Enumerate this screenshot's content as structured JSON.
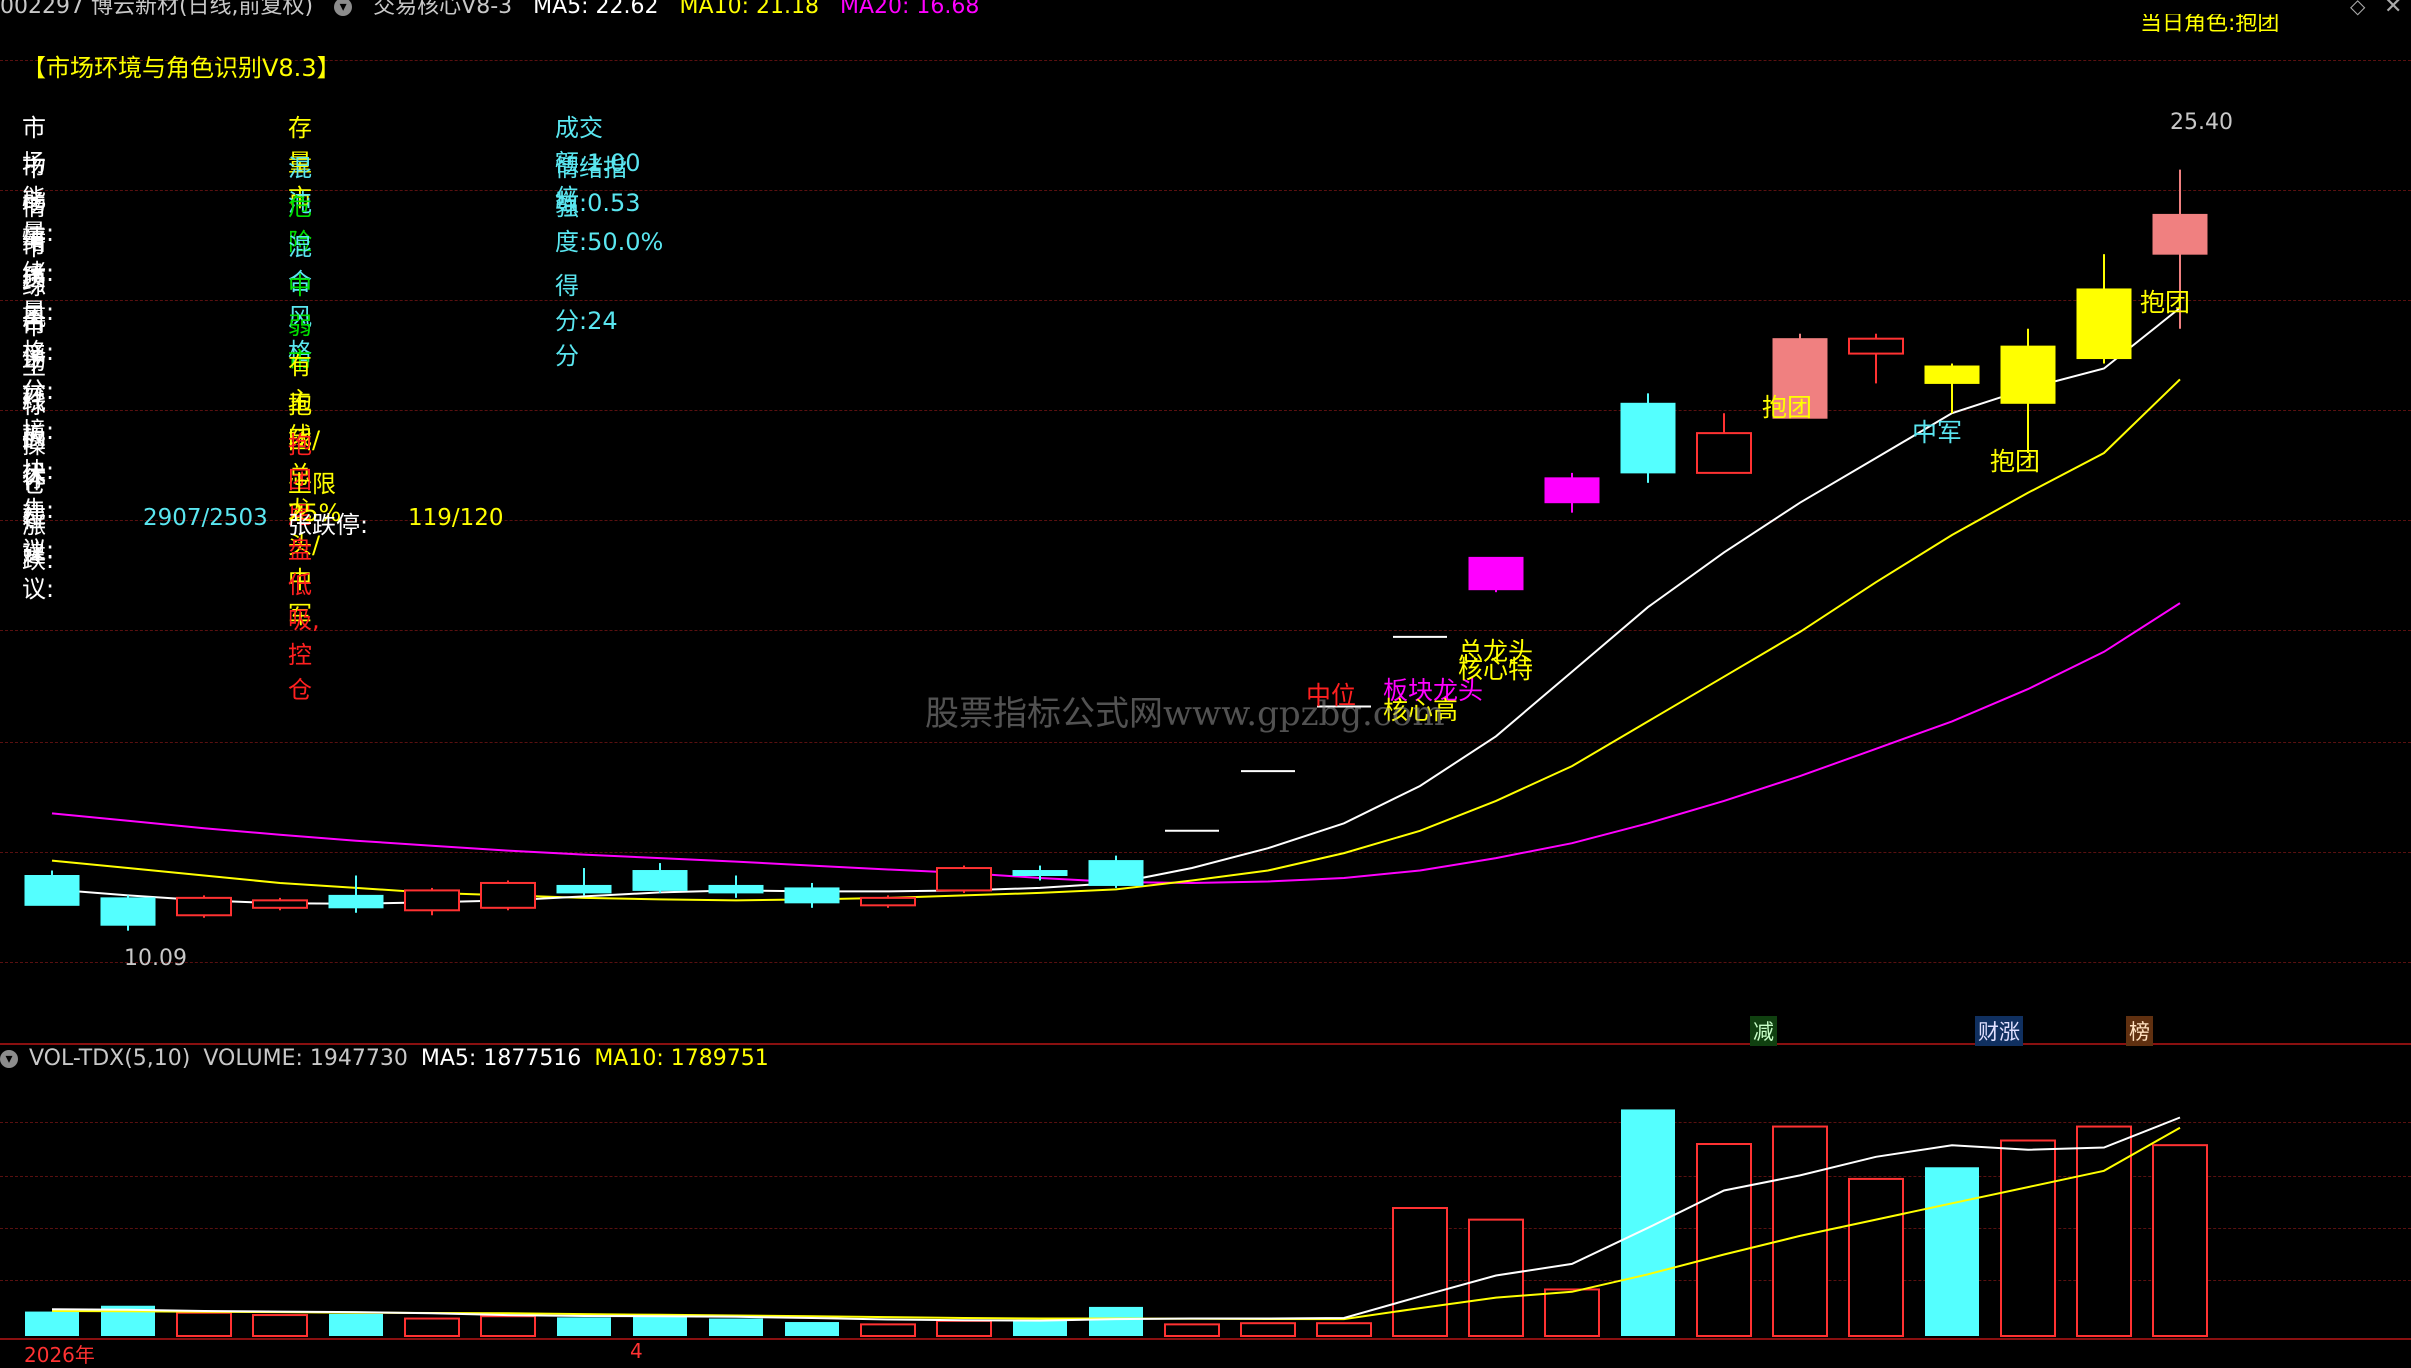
{
  "header": {
    "stock": "002297 博云新材(日线,前复权)",
    "indicator": "交易核心V8-3",
    "ma5_label": "MA5: 22.62",
    "ma10_label": "MA10: 21.18",
    "ma20_label": "MA20: 16.68",
    "right_label": "当日角色:抱团",
    "ma5_color": "#ffffff",
    "ma10_color": "#ffff00",
    "ma20_color": "#ff00ff"
  },
  "panel": {
    "title": "【市场环境与角色识别V8.3】",
    "rows": [
      {
        "label": "市场能量:",
        "value": "存量市",
        "value_color": "#ffff00",
        "extra": "成交额:1.00倍"
      },
      {
        "label": "市场情绪:",
        "value": "混沌",
        "value_color": "#5ae6f0",
        "extra": "情绪指数:0.53"
      },
      {
        "label": "情绪质量:",
        "value": "危险",
        "value_color": "#00e000",
        "extra": "强度:50.0%"
      },
      {
        "label": "市场风格:",
        "value": "混合风格",
        "value_color": "#5ae6f0",
        "extra": ""
      },
      {
        "label": "综合评分:",
        "value": "中",
        "value_color": "#00e000",
        "extra": "得分:24分"
      },
      {
        "label": "市场环境:",
        "value": "弱市",
        "value_color": "#00e000",
        "extra": ""
      },
      {
        "label": "主线板块:",
        "value": "有主线",
        "value_color": "#ffff00",
        "extra": ""
      },
      {
        "label": "标的优先:",
        "value": "抱团/总龙头/中军",
        "value_color": "#ffff00",
        "extra": ""
      },
      {
        "label": "操作建议:",
        "value": "抱团尾盘低吸, 控仓",
        "value_color": "#ff2020",
        "extra": ""
      },
      {
        "label": "仓位建议:",
        "value": "上限25%",
        "value_color": "#ffff00",
        "extra": ""
      }
    ],
    "zhangdie": {
      "label": "涨跌:",
      "value": "2907/2503",
      "label2": "张跌停:",
      "value2": "119/120"
    }
  },
  "annotations": {
    "zhongwei": "中位",
    "bankuai_longtou": "板块龙头",
    "hexin_gao": "核心高",
    "zong_longtou": "总龙头",
    "hexin_te": "核心特",
    "baotuan1": "抱团",
    "zhongjun": "中军",
    "baotuan2": "抱团",
    "baotuan3": "抱团",
    "high_label": "25.40",
    "low_label": "10.09",
    "watermark": "股票指标公式网www.gpzbg.com"
  },
  "markers": {
    "jian": "减",
    "caizhang": "财涨",
    "bang": "榜"
  },
  "volume": {
    "title": "VOL-TDX(5,10)",
    "volume_label": "VOLUME: 1947730",
    "ma5_label": "MA5: 1877516",
    "ma10_label": "MA10: 1789751"
  },
  "footer": {
    "year": "2026年",
    "month": "4"
  },
  "chart_data": {
    "type": "candlestick",
    "ylim": [
      9.5,
      26.5
    ],
    "up_color": "#ff3232",
    "down_color": "#54ffff",
    "limit_up_colors": [
      "#ff00ff",
      "#f08080",
      "#ffff00"
    ],
    "candles": [
      {
        "o": 11.2,
        "h": 11.3,
        "l": 10.6,
        "c": 10.6,
        "kind": "down"
      },
      {
        "o": 10.75,
        "h": 10.8,
        "l": 10.09,
        "c": 10.2,
        "kind": "down"
      },
      {
        "o": 10.4,
        "h": 10.8,
        "l": 10.35,
        "c": 10.75,
        "kind": "up"
      },
      {
        "o": 10.55,
        "h": 10.75,
        "l": 10.5,
        "c": 10.7,
        "kind": "up"
      },
      {
        "o": 10.8,
        "h": 11.2,
        "l": 10.45,
        "c": 10.55,
        "kind": "down"
      },
      {
        "o": 10.5,
        "h": 10.95,
        "l": 10.4,
        "c": 10.9,
        "kind": "up"
      },
      {
        "o": 10.55,
        "h": 11.1,
        "l": 10.5,
        "c": 11.05,
        "kind": "up"
      },
      {
        "o": 11.0,
        "h": 11.35,
        "l": 10.8,
        "c": 10.85,
        "kind": "down"
      },
      {
        "o": 11.3,
        "h": 11.45,
        "l": 10.85,
        "c": 10.9,
        "kind": "down"
      },
      {
        "o": 11.0,
        "h": 11.2,
        "l": 10.75,
        "c": 10.85,
        "kind": "down"
      },
      {
        "o": 10.95,
        "h": 11.05,
        "l": 10.55,
        "c": 10.65,
        "kind": "down"
      },
      {
        "o": 10.6,
        "h": 10.8,
        "l": 10.55,
        "c": 10.75,
        "kind": "up"
      },
      {
        "o": 10.9,
        "h": 11.4,
        "l": 10.85,
        "c": 11.35,
        "kind": "up"
      },
      {
        "o": 11.3,
        "h": 11.4,
        "l": 11.1,
        "c": 11.2,
        "kind": "down"
      },
      {
        "o": 11.5,
        "h": 11.6,
        "l": 10.95,
        "c": 11.0,
        "kind": "down"
      },
      {
        "o": 12.1,
        "h": 12.1,
        "l": 12.1,
        "c": 12.1,
        "kind": "line"
      },
      {
        "o": 13.3,
        "h": 13.3,
        "l": 13.3,
        "c": 13.3,
        "kind": "line"
      },
      {
        "o": 14.6,
        "h": 14.6,
        "l": 14.6,
        "c": 14.6,
        "kind": "line"
      },
      {
        "o": 16.0,
        "h": 16.0,
        "l": 15.9,
        "c": 16.0,
        "kind": "line"
      },
      {
        "o": 16.95,
        "h": 17.6,
        "l": 16.9,
        "c": 17.6,
        "kind": "limit1"
      },
      {
        "o": 18.7,
        "h": 19.3,
        "l": 18.5,
        "c": 19.2,
        "kind": "limit1"
      },
      {
        "o": 19.3,
        "h": 20.9,
        "l": 19.1,
        "c": 20.7,
        "kind": "down"
      },
      {
        "o": 19.3,
        "h": 20.5,
        "l": 19.3,
        "c": 20.1,
        "kind": "up"
      },
      {
        "o": 20.4,
        "h": 22.1,
        "l": 20.4,
        "c": 22.0,
        "kind": "limit2"
      },
      {
        "o": 21.7,
        "h": 22.1,
        "l": 21.1,
        "c": 22.0,
        "kind": "up"
      },
      {
        "o": 21.1,
        "h": 21.5,
        "l": 20.5,
        "c": 21.45,
        "kind": "limit3"
      },
      {
        "o": 20.7,
        "h": 22.2,
        "l": 19.7,
        "c": 21.85,
        "kind": "limit3"
      },
      {
        "o": 21.6,
        "h": 23.7,
        "l": 21.5,
        "c": 23.0,
        "kind": "limit3"
      },
      {
        "o": 23.7,
        "h": 25.4,
        "l": 22.2,
        "c": 24.5,
        "kind": "limit2"
      }
    ],
    "ma5": [
      10.92,
      10.8,
      10.7,
      10.64,
      10.63,
      10.66,
      10.7,
      10.78,
      10.86,
      10.9,
      10.88,
      10.88,
      10.9,
      10.95,
      11.05,
      11.35,
      11.75,
      12.25,
      13.0,
      14.0,
      15.3,
      16.6,
      17.7,
      18.7,
      19.6,
      20.5,
      21.0,
      21.4,
      22.62
    ],
    "ma10": [
      11.5,
      11.35,
      11.2,
      11.05,
      10.95,
      10.85,
      10.8,
      10.75,
      10.72,
      10.7,
      10.72,
      10.75,
      10.8,
      10.85,
      10.92,
      11.1,
      11.3,
      11.65,
      12.1,
      12.7,
      13.4,
      14.3,
      15.2,
      16.1,
      17.1,
      18.05,
      18.9,
      19.7,
      21.18
    ],
    "ma20": [
      12.45,
      12.3,
      12.15,
      12.02,
      11.9,
      11.8,
      11.7,
      11.62,
      11.55,
      11.48,
      11.4,
      11.32,
      11.25,
      11.15,
      11.07,
      11.05,
      11.08,
      11.15,
      11.3,
      11.55,
      11.85,
      12.25,
      12.7,
      13.2,
      13.75,
      14.3,
      14.95,
      15.7,
      16.68
    ],
    "volume": {
      "ylim": [
        0,
        2200000
      ],
      "bars": [
        210000,
        260000,
        200000,
        180000,
        190000,
        150000,
        170000,
        160000,
        170000,
        150000,
        120000,
        100000,
        130000,
        140000,
        250000,
        100000,
        110000,
        110000,
        1100000,
        1000000,
        400000,
        1947000,
        1650000,
        1800000,
        1350000,
        1450000,
        1680000,
        1800000,
        1640000
      ],
      "kinds": [
        "down",
        "down",
        "up",
        "up",
        "down",
        "up",
        "up",
        "down",
        "down",
        "down",
        "down",
        "up",
        "up",
        "down",
        "down",
        "up",
        "up",
        "up",
        "up",
        "up",
        "up",
        "down",
        "up",
        "up",
        "up",
        "down",
        "up",
        "up",
        "up"
      ],
      "ma5": [
        230000,
        225000,
        215000,
        210000,
        205000,
        195000,
        180000,
        172000,
        170000,
        165000,
        155000,
        142000,
        135000,
        132000,
        145000,
        150000,
        150000,
        155000,
        340000,
        520000,
        620000,
        930000,
        1250000,
        1380000,
        1540000,
        1640000,
        1600000,
        1620000,
        1877516
      ],
      "ma10": [
        215000,
        212000,
        208000,
        205000,
        200000,
        198000,
        195000,
        188000,
        182000,
        176000,
        170000,
        162000,
        155000,
        150000,
        150000,
        148000,
        146000,
        145000,
        240000,
        330000,
        380000,
        530000,
        700000,
        860000,
        1000000,
        1140000,
        1280000,
        1420000,
        1789751
      ]
    }
  }
}
